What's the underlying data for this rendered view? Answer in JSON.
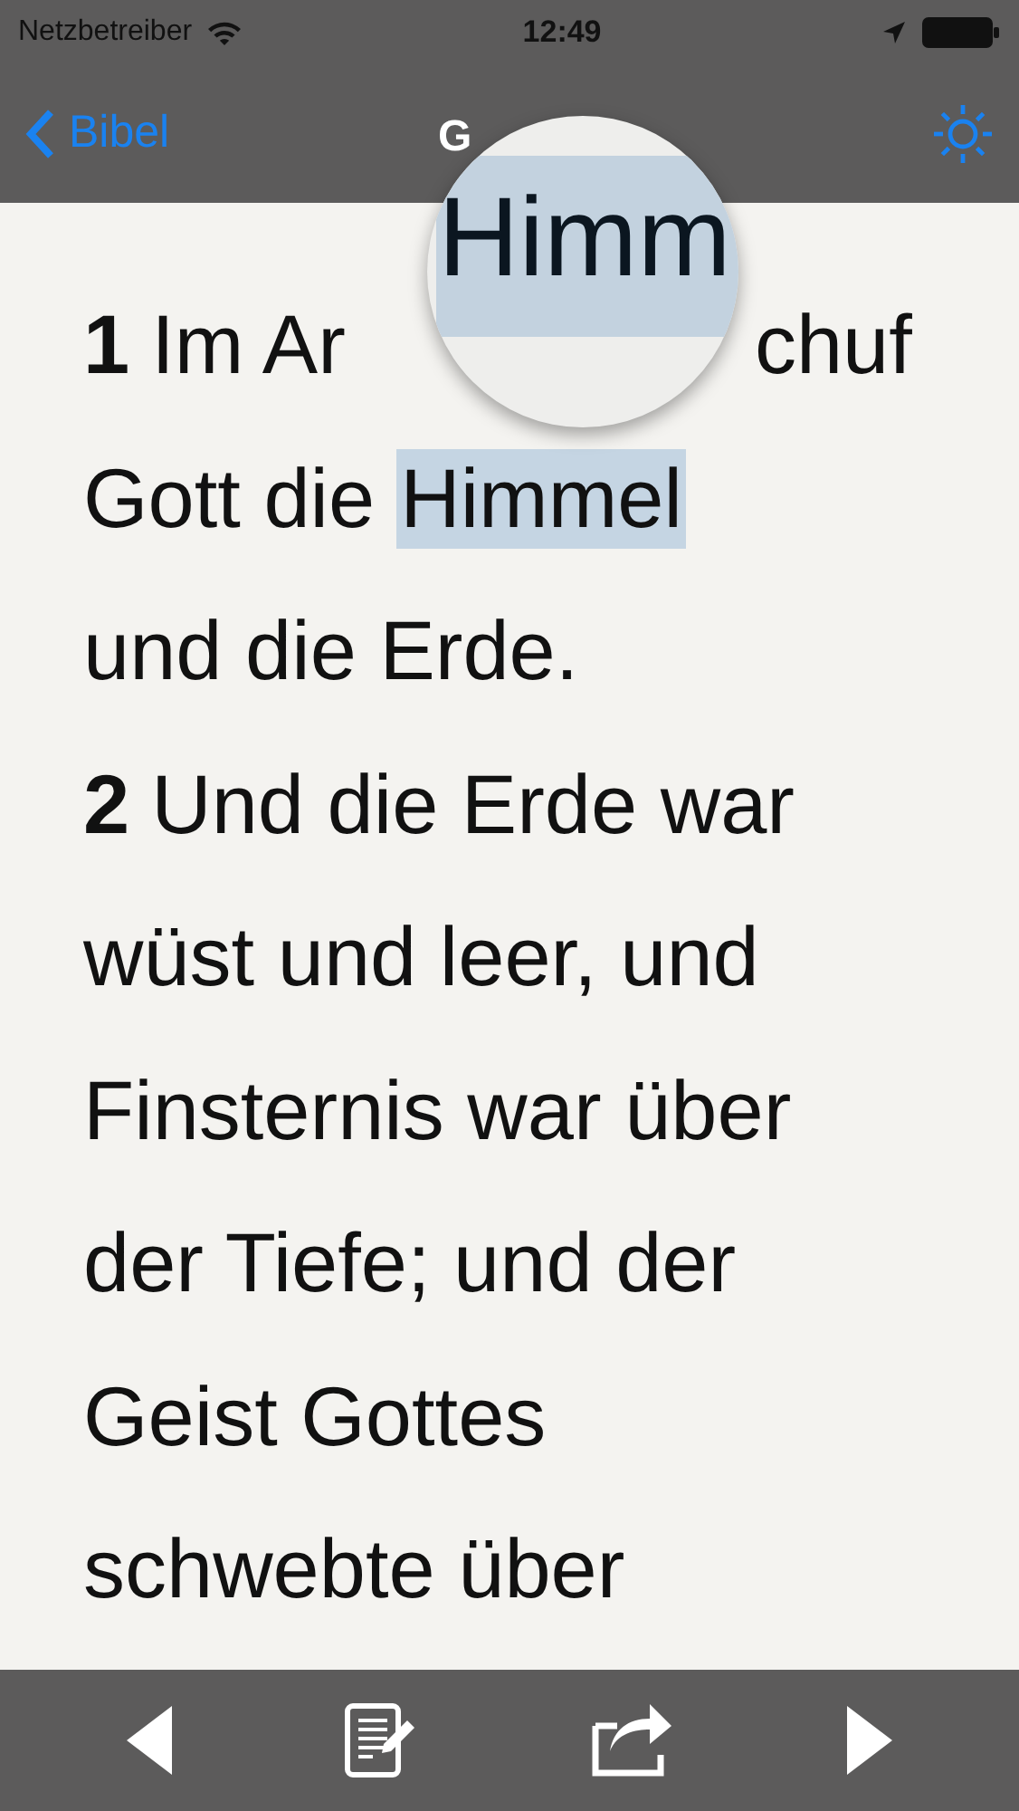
{
  "status_bar": {
    "carrier": "Netzbetreiber",
    "time": "12:49"
  },
  "nav_bar": {
    "back": "Bibel",
    "title": "G"
  },
  "lines": [
    {
      "parts": [
        {
          "text": "1",
          "kind": "verse_number"
        },
        {
          "text": "Im Ar",
          "kind": "text"
        },
        {
          "text": "chuf",
          "kind": "gap_text"
        }
      ]
    },
    {
      "parts": [
        {
          "text": "Gott die",
          "kind": "text"
        },
        {
          "text": "Himmel",
          "kind": "selection"
        }
      ]
    },
    {
      "parts": [
        {
          "text": "und die Erde.",
          "kind": "text"
        }
      ]
    },
    {
      "parts": [
        {
          "text": "2",
          "kind": "verse_number"
        },
        {
          "text": "Und die Erde war",
          "kind": "text"
        }
      ]
    },
    {
      "parts": [
        {
          "text": "wüst und leer, und",
          "kind": "text"
        }
      ]
    },
    {
      "parts": [
        {
          "text": "Finsternis war über",
          "kind": "text"
        }
      ]
    },
    {
      "parts": [
        {
          "text": "der Tiefe; und der",
          "kind": "text"
        }
      ]
    },
    {
      "parts": [
        {
          "text": "Geist Gottes",
          "kind": "text"
        }
      ]
    },
    {
      "parts": [
        {
          "text": "schwebte über",
          "kind": "text"
        }
      ]
    }
  ],
  "magnifier": {
    "text": "Himm"
  },
  "toolbar": [
    {
      "kind": "previous"
    },
    {
      "kind": "notes"
    },
    {
      "kind": "share"
    },
    {
      "kind": "next"
    }
  ]
}
